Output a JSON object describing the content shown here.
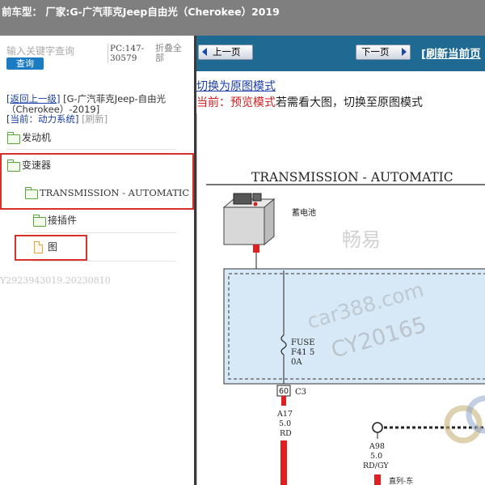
{
  "title_bar": {
    "text": "前车型：  厂家:G-广汽菲克Jeep自由光（Cherokee）2019"
  },
  "sidebar": {
    "search_placeholder": "输入关键字查询",
    "query_button": "查询",
    "pc_code": "PC:147-30579",
    "fold_all": "折叠全部",
    "back_link": "[返回上一级]",
    "back_path": "[G-广汽菲克Jeep-自由光（Cherokee）-2019]",
    "current_label": "[当前：动力系统]",
    "refresh": "[刷新]",
    "tree": [
      {
        "label": "发动机",
        "icon": "folder-icon"
      },
      {
        "label": "变速器",
        "icon": "folder-icon"
      },
      {
        "label": "TRANSMISSION - AUTOMATIC",
        "icon": "folder-icon"
      },
      {
        "label": "接插件",
        "icon": "folder-icon"
      },
      {
        "label": "图",
        "icon": "document-icon"
      }
    ],
    "version": "Y2923943019.20230810",
    "highlight_color": "#d9302c"
  },
  "toolbar": {
    "prev_page": "上一页",
    "next_page": "下一页",
    "refresh_current": "[刷新当前页"
  },
  "content": {
    "switch_mode_link": "切换为原图模式",
    "mode_current_label": "当前：预览模式",
    "mode_hint": "若需看大图，切换至原图模式"
  },
  "diagram": {
    "title": "TRANSMISSION - AUTOMATIC",
    "battery_label": "蓄电池",
    "fuse_label_1": "FUSE",
    "fuse_label_2": "F41 5",
    "fuse_label_3": "0A",
    "connector_pin": "60",
    "connector_name": "C3",
    "wire_1_id": "A17",
    "wire_1_gauge": "5.0",
    "wire_1_color": "RD",
    "wire_2_id": "A98",
    "wire_2_gauge": "5.0",
    "wire_2_color": "RD/GY",
    "wire_2_note": "直列-东",
    "watermark_1": "畅易",
    "watermark_2": "car388.com",
    "watermark_3": "CY20165"
  },
  "colors": {
    "toolbar_bg": "#1e6a93",
    "title_bg": "#7f7f7f",
    "wire_red": "#e02020",
    "fuse_box": "#d7e8f6"
  }
}
